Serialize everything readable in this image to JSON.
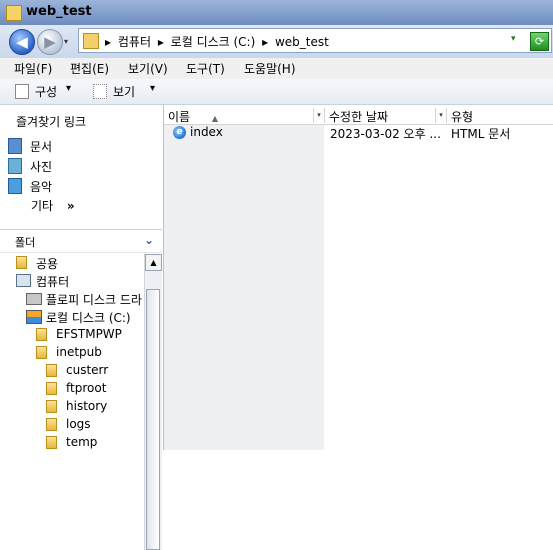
{
  "window": {
    "title": "web_test"
  },
  "address": {
    "segments": [
      "컴퓨터",
      "로컬 디스크 (C:)",
      "web_test"
    ],
    "separator": "▸",
    "dropdown_glyph": "▾"
  },
  "menu": [
    "파일(F)",
    "편집(E)",
    "보기(V)",
    "도구(T)",
    "도움말(H)"
  ],
  "toolbar": {
    "organize": "구성",
    "views": "보기",
    "dd": "▾"
  },
  "favorites": {
    "title": "즐겨찾기 링크",
    "items": [
      {
        "label": "문서",
        "icon": "documents-icon"
      },
      {
        "label": "사진",
        "icon": "pictures-icon"
      },
      {
        "label": "음악",
        "icon": "music-icon"
      }
    ],
    "more": "기타",
    "more_glyph": "»"
  },
  "folders": {
    "label": "폴더",
    "tree": [
      {
        "label": "공용",
        "indent": 0,
        "icon": "folder-icon"
      },
      {
        "label": "컴퓨터",
        "indent": 0,
        "icon": "computer-icon"
      },
      {
        "label": "플로피 디스크 드라",
        "indent": 1,
        "icon": "floppy-icon"
      },
      {
        "label": "로컬 디스크 (C:)",
        "indent": 1,
        "icon": "drive-icon"
      },
      {
        "label": "EFSTMPWP",
        "indent": 2,
        "icon": "folder-icon"
      },
      {
        "label": "inetpub",
        "indent": 2,
        "icon": "folder-icon"
      },
      {
        "label": "custerr",
        "indent": 3,
        "icon": "folder-icon"
      },
      {
        "label": "ftproot",
        "indent": 3,
        "icon": "folder-icon"
      },
      {
        "label": "history",
        "indent": 3,
        "icon": "folder-icon"
      },
      {
        "label": "logs",
        "indent": 3,
        "icon": "folder-icon"
      },
      {
        "label": "temp",
        "indent": 3,
        "icon": "folder-icon"
      }
    ]
  },
  "columns": [
    {
      "label": "이름",
      "sorted": true
    },
    {
      "label": "수정한 날짜"
    },
    {
      "label": "유형"
    }
  ],
  "files": [
    {
      "name": "index",
      "modified": "2023-03-02 오후 ...",
      "type": "HTML 문서",
      "icon": "ie-html-icon"
    }
  ],
  "colors": {
    "titlebar": "#6d8cc0",
    "folder": "#f3d06a"
  }
}
